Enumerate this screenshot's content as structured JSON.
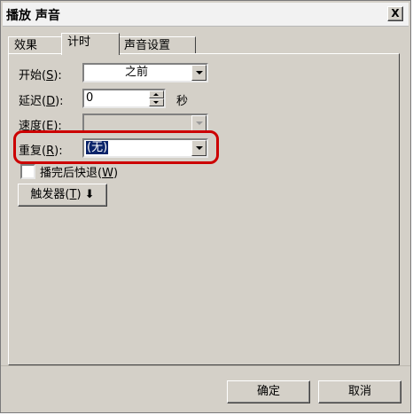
{
  "window": {
    "title": "播放 声音",
    "close_label": "X"
  },
  "tabs": [
    {
      "label": "效果",
      "active": false
    },
    {
      "label": "计时",
      "active": true
    },
    {
      "label": "声音设置",
      "active": false
    }
  ],
  "timing": {
    "start": {
      "label": "开始",
      "hotkey": "S",
      "value": "之前"
    },
    "delay": {
      "label": "延迟",
      "hotkey": "D",
      "value": "0",
      "unit": "秒"
    },
    "speed": {
      "label": "速度",
      "hotkey": "E",
      "value": ""
    },
    "repeat": {
      "label": "重复",
      "hotkey": "R",
      "value": "(无)"
    },
    "rewind": {
      "label": "播完后快退",
      "hotkey": "W",
      "checked": false
    },
    "triggers": {
      "label": "触发器",
      "hotkey": "T"
    }
  },
  "footer": {
    "ok": "确定",
    "cancel": "取消"
  },
  "colors": {
    "dialog_bg": "#d4d0c8",
    "highlight_ring": "#cc0000",
    "selection": "#0a246a"
  }
}
